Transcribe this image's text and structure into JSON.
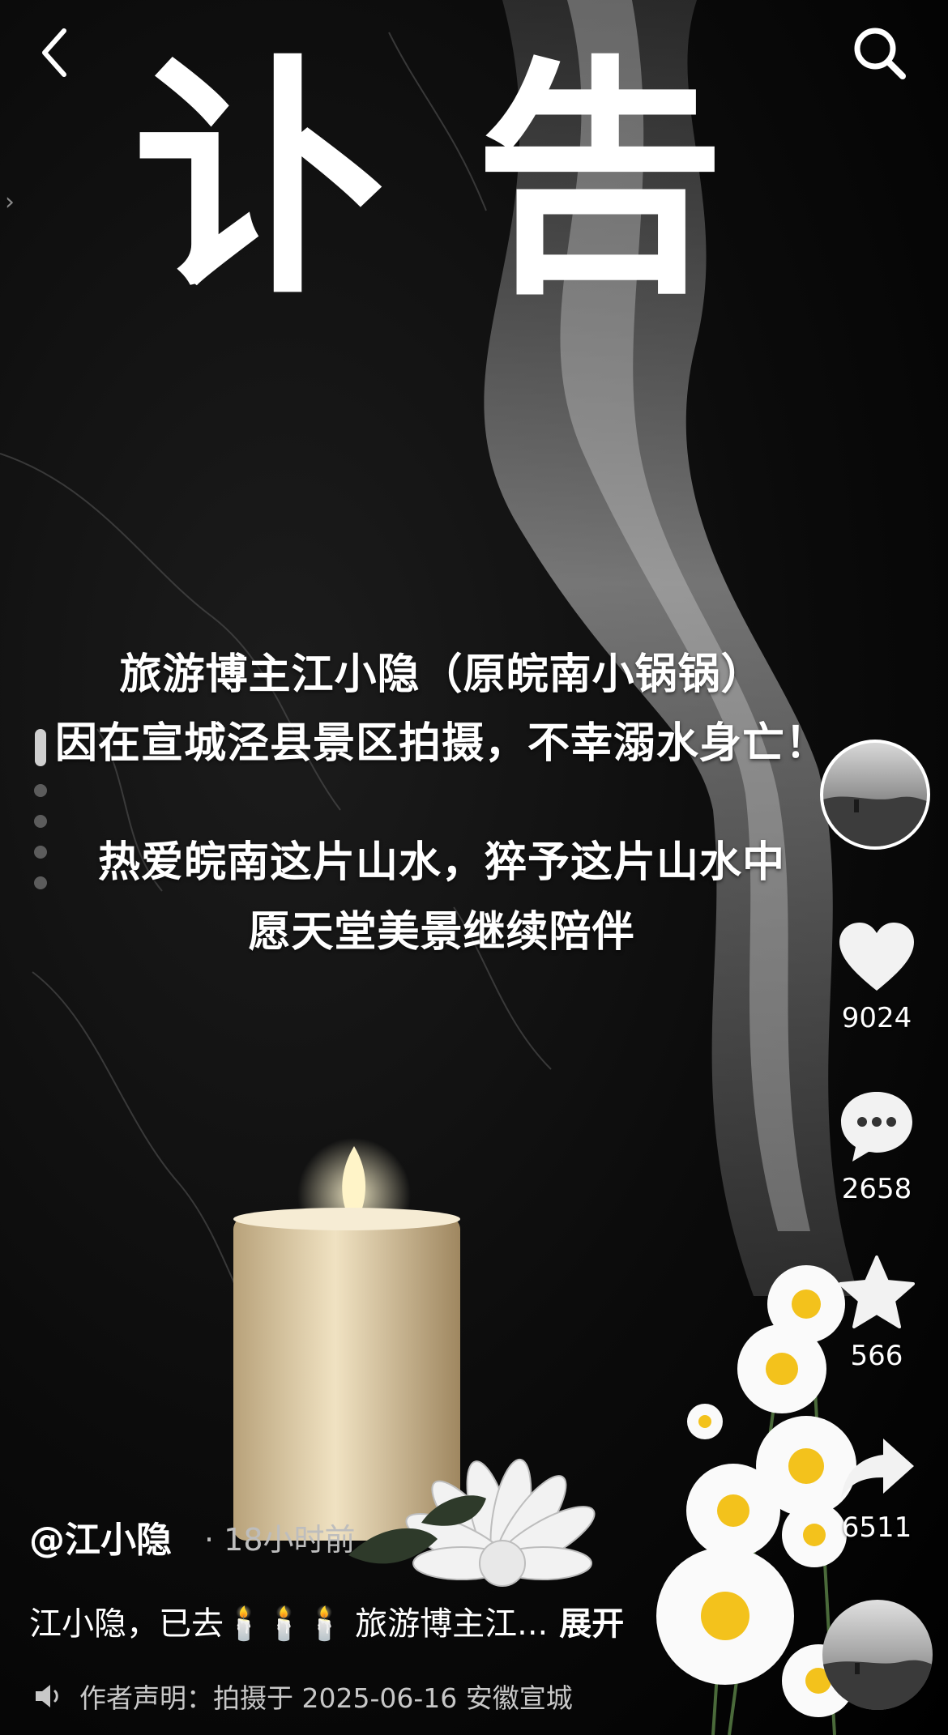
{
  "title": "讣告",
  "notice_lines": [
    "旅游博主江小隐（原皖南小锅锅）",
    "因在宣城泾县景区拍摄，不幸溺水身亡！",
    "热爱皖南这片山水，猝予这片山水中",
    "愿天堂美景继续陪伴"
  ],
  "actions": {
    "like_count": "9024",
    "comment_count": "2658",
    "favorite_count": "566",
    "share_count": "6511"
  },
  "post": {
    "author": "@江小隐",
    "time": "18小时前",
    "caption": "江小隐，已去🕯️🕯️🕯️ 旅游博主江...",
    "expand_label": "展开",
    "declaration": "作者声明：拍摄于 2025-06-16 安徽宣城"
  },
  "icons": [
    "back-arrow-icon",
    "search-icon",
    "heart-icon",
    "comment-icon",
    "star-icon",
    "share-icon",
    "speaker-icon"
  ]
}
